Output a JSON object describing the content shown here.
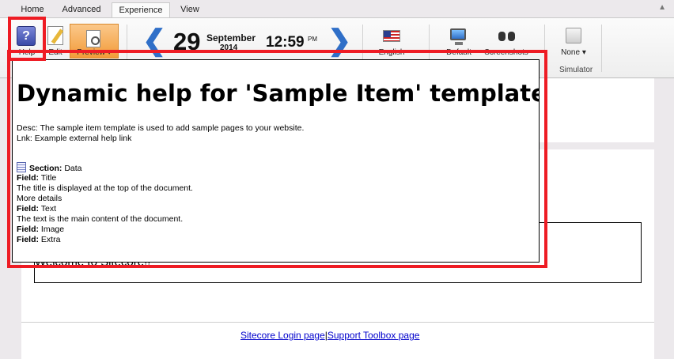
{
  "tabs": [
    "Home",
    "Advanced",
    "Experience",
    "View"
  ],
  "active_tab": "Experience",
  "ribbon": {
    "help_label": "Help",
    "edit_label": "Edit",
    "preview_label": "Preview",
    "date_day": "29",
    "date_month": "September",
    "date_year": "2014",
    "time": "12:59",
    "ampm": "PM",
    "language_label": "English",
    "device_label": "Default",
    "screenshots_label": "Screenshots",
    "simulator_value": "None",
    "simulator_group": "Simulator"
  },
  "help_popup": {
    "title": "Dynamic help for 'Sample Item' template",
    "desc": "Desc: The sample item template is used to add sample pages to your website.",
    "link": "Lnk: Example external help link",
    "section_label": "Section:",
    "section_value": "Data",
    "fields": [
      {
        "label": "Field:",
        "name": "Title"
      },
      {
        "label": "Field:",
        "name": "Text"
      },
      {
        "label": "Field:",
        "name": "Image"
      },
      {
        "label": "Field:",
        "name": "Extra"
      }
    ],
    "title_desc": "The title is displayed at the top of the document.",
    "more_details": "More details",
    "text_desc": "The text is the main content of the document."
  },
  "page": {
    "welcome": "Welcome to Sitecore!!",
    "footer_login": "Sitecore Login page",
    "footer_separator": "|",
    "footer_support": "Support Toolbox page"
  },
  "colors": {
    "highlight": "#ee1c24",
    "accent_blue": "#2f6fc8",
    "preview_orange": "#f29b39",
    "link": "#0000cc"
  },
  "icons": [
    "help-icon",
    "edit-icon",
    "preview-icon",
    "arrow-left-icon",
    "arrow-right-icon",
    "flag-us-icon",
    "monitor-icon",
    "binoculars-icon",
    "device-icon",
    "section-icon"
  ]
}
